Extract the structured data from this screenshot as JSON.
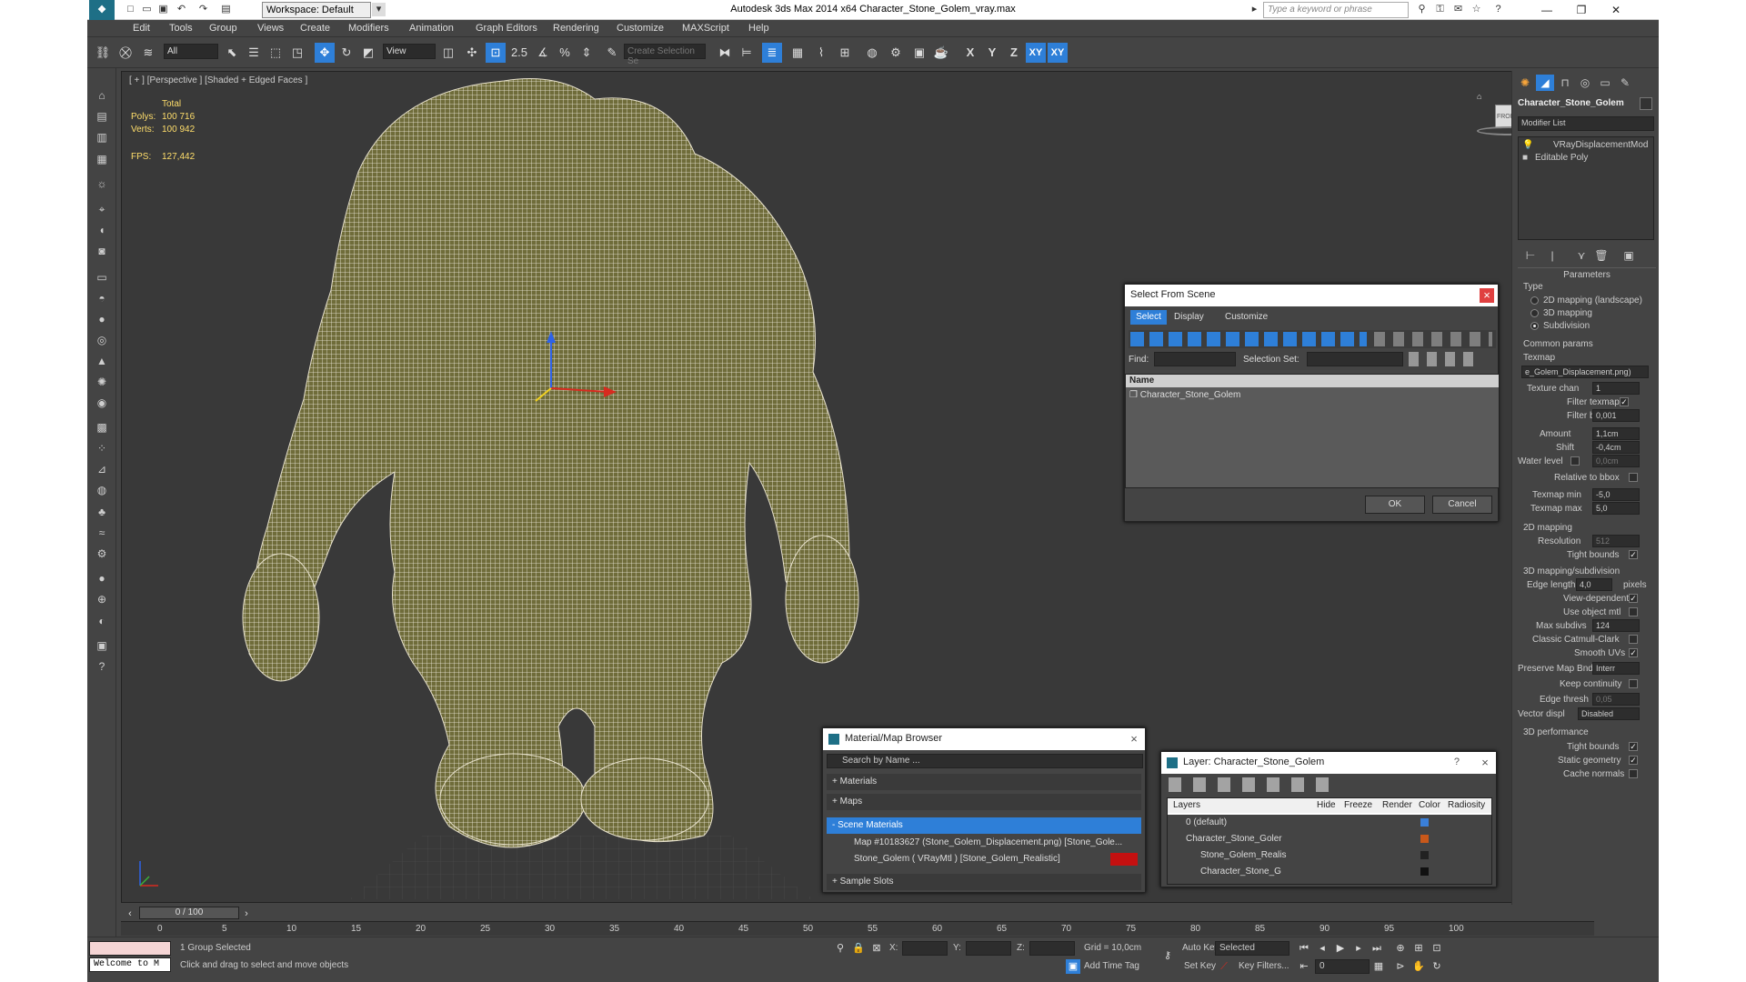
{
  "window": {
    "title": "Autodesk 3ds Max  2014 x64     Character_Stone_Golem_vray.max",
    "workspace": "Workspace: Default",
    "search_placeholder": "Type a keyword or phrase"
  },
  "menu": [
    "Edit",
    "Tools",
    "Group",
    "Views",
    "Create",
    "Modifiers",
    "Animation",
    "Graph Editors",
    "Rendering",
    "Customize",
    "MAXScript",
    "Help"
  ],
  "toolbar": {
    "filter_value": "All",
    "ref_coord_value": "View",
    "snap_angle_label": "2.5",
    "selection_set_placeholder": "Create Selection Se",
    "axis_x": "X",
    "axis_y": "Y",
    "axis_z": "Z",
    "axis_xy": "XY",
    "axis_xy2": "XY"
  },
  "viewport": {
    "label": "[ + ] [Perspective ] [Shaded + Edged Faces ]",
    "stats": {
      "total_label": "Total",
      "polys_label": "Polys:",
      "polys_value": "100 716",
      "verts_label": "Verts:",
      "verts_value": "100 942",
      "fps_label": "FPS:",
      "fps_value": "127,442"
    },
    "viewcube_label": "FRONT"
  },
  "select_from_scene": {
    "title": "Select From Scene",
    "tabs": [
      "Select",
      "Display",
      "Customize"
    ],
    "find_label": "Find:",
    "selection_set_label": "Selection Set:",
    "column_name": "Name",
    "items": [
      "Character_Stone_Golem"
    ],
    "ok": "OK",
    "cancel": "Cancel"
  },
  "material_browser": {
    "title": "Material/Map Browser",
    "search_placeholder": "Search by Name ...",
    "groups": {
      "materials": "+ Materials",
      "maps": "+ Maps",
      "scene_materials": "- Scene Materials",
      "sample_slots": "+ Sample Slots"
    },
    "scene_items": [
      "Map #10183627 (Stone_Golem_Displacement.png) [Stone_Gole...",
      "Stone_Golem  ( VRayMtl ) [Stone_Golem_Realistic]"
    ]
  },
  "layer_dialog": {
    "title": "Layer: Character_Stone_Golem",
    "help": "?",
    "columns": [
      "Layers",
      "Hide",
      "Freeze",
      "Render",
      "Color",
      "Radiosity"
    ],
    "rows": [
      {
        "name": "0 (default)",
        "color": "#3a7fd8"
      },
      {
        "name": "Character_Stone_Goler",
        "color": "#c8581a"
      },
      {
        "name": "Stone_Golem_Realis",
        "color": "#222222"
      },
      {
        "name": "Character_Stone_G",
        "color": "#111111"
      }
    ]
  },
  "command_panel": {
    "object_name": "Character_Stone_Golem",
    "modifier_list": "Modifier List",
    "stack": [
      "VRayDisplacementMod",
      "Editable Poly"
    ],
    "parameters_title": "Parameters",
    "type_label": "Type",
    "type_options": [
      "2D mapping (landscape)",
      "3D mapping",
      "Subdivision"
    ],
    "common_params": "Common params",
    "texmap_label": "Texmap",
    "texmap_value": "e_Golem_Displacement.png)",
    "texture_chan_label": "Texture chan",
    "texture_chan_value": "1",
    "filter_texmap_label": "Filter texmap",
    "filter_blur_label": "Filter blur",
    "filter_blur_value": "0,001",
    "amount_label": "Amount",
    "amount_value": "1,1cm",
    "shift_label": "Shift",
    "shift_value": "-0,4cm",
    "water_level_label": "Water level",
    "water_level_value": "0,0cm",
    "relative_bbox_label": "Relative to bbox",
    "texmap_min_label": "Texmap min",
    "texmap_min_value": "-5,0",
    "texmap_max_label": "Texmap max",
    "texmap_max_value": "5,0",
    "mapping_2d": "2D mapping",
    "resolution_label": "Resolution",
    "resolution_value": "512",
    "tight_bounds_label": "Tight bounds",
    "mapping_3d": "3D mapping/subdivision",
    "edge_length_label": "Edge length",
    "edge_length_value": "4,0",
    "pixels_label": "pixels",
    "view_dependent_label": "View-dependent",
    "use_object_mtl_label": "Use object mtl",
    "max_subdivs_label": "Max subdivs",
    "max_subdivs_value": "124",
    "classic_cc_label": "Classic Catmull-Clark",
    "smooth_uvs_label": "Smooth UVs",
    "preserve_map_label": "Preserve Map Bnd",
    "preserve_map_value": "Interr",
    "keep_continuity_label": "Keep continuity",
    "edge_thresh_label": "Edge thresh",
    "edge_thresh_value": "0,05",
    "vector_displ_label": "Vector displ",
    "vector_displ_value": "Disabled",
    "perf_title": "3D performance",
    "perf_tight_bounds_label": "Tight bounds",
    "static_geometry_label": "Static geometry",
    "cache_normals_label": "Cache normals"
  },
  "timeline": {
    "frame_counter": "0 / 100",
    "ticks": [
      "0",
      "5",
      "10",
      "15",
      "20",
      "25",
      "30",
      "35",
      "40",
      "45",
      "50",
      "55",
      "60",
      "65",
      "70",
      "75",
      "80",
      "85",
      "90",
      "95",
      "100"
    ]
  },
  "status": {
    "maxscript_text": "Welcome to M",
    "selected": "1 Group Selected",
    "prompt": "Click and drag to select and move objects",
    "x_label": "X:",
    "y_label": "Y:",
    "z_label": "Z:",
    "grid": "Grid = 10,0cm",
    "add_time_tag": "Add Time Tag",
    "auto_key": "Auto Key",
    "set_key": "Set Key",
    "selected_value": "Selected",
    "key_filters": "Key Filters...",
    "frame_value": "0"
  }
}
